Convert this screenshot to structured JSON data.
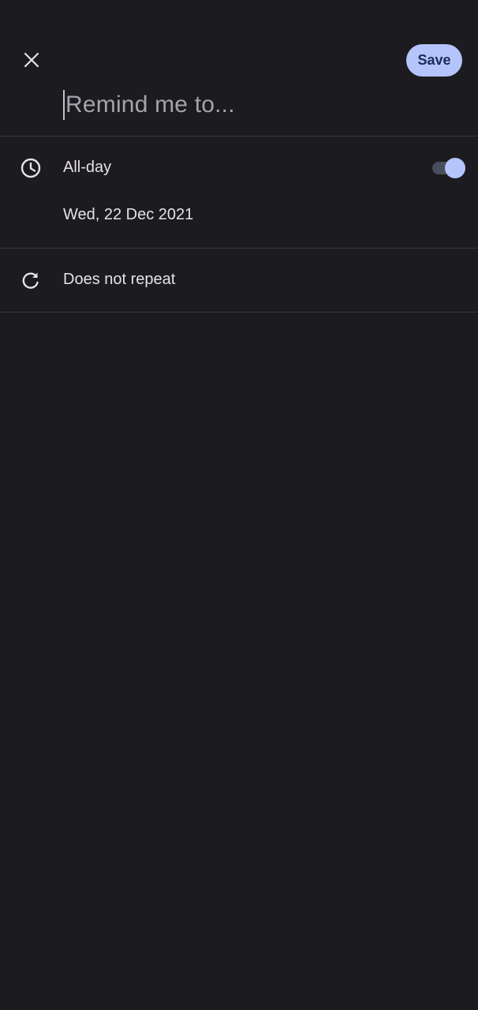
{
  "header": {
    "close_icon": "close-icon",
    "save_label": "Save",
    "title_placeholder": "Remind me to..."
  },
  "all_day": {
    "icon": "clock-icon",
    "label": "All-day",
    "toggle_on": true,
    "date": "Wed, 22 Dec 2021"
  },
  "repeat": {
    "icon": "repeat-icon",
    "label": "Does not repeat"
  },
  "colors": {
    "background": "#1c1b1f",
    "accent": "#b4c5fb",
    "divider": "#3a383f"
  }
}
